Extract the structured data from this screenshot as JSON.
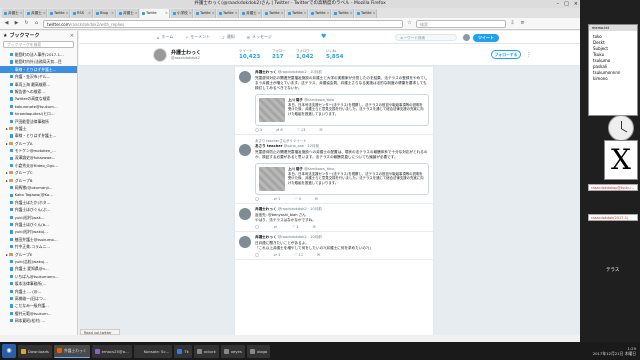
{
  "window": {
    "title": "弁護士わっく(@raackdokdok2)さん | Twitter - Twitterでの高精度のラベル - Mozilla Firefox",
    "controls": [
      "–",
      "□",
      "×"
    ]
  },
  "tabs": [
    {
      "label": "弁護士",
      "active": false
    },
    {
      "label": "弁護士",
      "active": false
    },
    {
      "label": "Twitte",
      "active": false
    },
    {
      "label": "RSS",
      "active": false
    },
    {
      "label": "Blog",
      "active": false
    },
    {
      "label": "弁護士",
      "active": false
    },
    {
      "label": "Twitte",
      "active": true
    },
    {
      "label": "小学校",
      "active": false
    },
    {
      "label": "Twitte",
      "active": false
    },
    {
      "label": "Twitte",
      "active": false
    },
    {
      "label": "弁護士",
      "active": false
    },
    {
      "label": "Twitte",
      "active": false
    },
    {
      "label": "Twitte",
      "active": false
    },
    {
      "label": "Twitte",
      "active": false
    },
    {
      "label": "Twitte",
      "active": false
    },
    {
      "label": "Twitte",
      "active": false
    }
  ],
  "navbar": {
    "url_host": "twitter.com",
    "url_path": "/raackdokdok2/with_replies",
    "search_placeholder": "検索"
  },
  "sidebar": {
    "title": "ブックマーク",
    "close": "×",
    "search_placeholder": "ブックマークを検索",
    "items": [
      {
        "label": "能登町の法人事件(2017-1…",
        "type": "fav",
        "selected": false
      },
      {
        "label": "能登町内外(法務局天気…目",
        "type": "fav",
        "selected": false
      },
      {
        "label": "車線・とりはず弁護士…",
        "type": "fav",
        "selected": true
      },
      {
        "label": "弁護・金沢市(ヤル…",
        "type": "fav",
        "selected": false
      },
      {
        "label": "車両上海 最高検察…",
        "type": "fav",
        "selected": false
      },
      {
        "label": "報告書への検索…",
        "type": "fav",
        "selected": false
      },
      {
        "label": "Twitterの高度な検索",
        "type": "fav",
        "selected": false
      },
      {
        "label": "kakuronote@tsukum…",
        "type": "fav",
        "selected": false
      },
      {
        "label": "hiroedaquitesi(ヒロ…",
        "type": "fav",
        "selected": false
      },
      {
        "label": "戸田能登法律事務所",
        "type": "fav",
        "selected": false
      },
      {
        "label": "弁護士",
        "type": "folder",
        "selected": false
      },
      {
        "label": "車線・とりはず弁護士…",
        "type": "fav",
        "selected": false
      },
      {
        "label": "グループA",
        "type": "folder",
        "selected": false
      },
      {
        "label": "モトケン@motoken_…",
        "type": "fav",
        "selected": false
      },
      {
        "label": "深澤諭史@fukazawa…",
        "type": "fav",
        "selected": false
      },
      {
        "label": "小倉秀夫@Hideo_Ogu…",
        "type": "fav",
        "selected": false
      },
      {
        "label": "グループC",
        "type": "folder",
        "selected": false
      },
      {
        "label": "グループB",
        "type": "folder",
        "selected": false
      },
      {
        "label": "岡馬猪(@okumanji…",
        "type": "fav",
        "selected": false
      },
      {
        "label": "Kako Tagawa(@Ka…",
        "type": "fav",
        "selected": false
      },
      {
        "label": "弁護士ほたか(ホタ…",
        "type": "fav",
        "selected": false
      },
      {
        "label": "弁護士ほびぐん(ぷ…",
        "type": "fav",
        "selected": false
      },
      {
        "label": "yuki(松村)wak…",
        "type": "fav",
        "selected": false
      },
      {
        "label": "弁護士ほびぐん(b…",
        "type": "fav",
        "selected": false
      },
      {
        "label": "yuki(松村)wakuj…",
        "type": "fav",
        "selected": false
      },
      {
        "label": "植田弁護士@tsukumo…",
        "type": "fav",
        "selected": false
      },
      {
        "label": "竹中正美-コラムニ…",
        "type": "fav",
        "selected": false
      },
      {
        "label": "グループE",
        "type": "folder",
        "selected": false
      },
      {
        "label": "yuki(吉松)wakuj…",
        "type": "fav",
        "selected": false
      },
      {
        "label": "弁護士 愛知県@n…",
        "type": "fav",
        "selected": false
      },
      {
        "label": "いちばん@tsukumonn…",
        "type": "fav",
        "selected": false
      },
      {
        "label": "坂本法律事務所(…",
        "type": "fav",
        "selected": false
      },
      {
        "label": "弁護士 … (@…",
        "type": "fav",
        "selected": false
      },
      {
        "label": "高橋雄一(旧はつ…",
        "type": "fav",
        "selected": false
      },
      {
        "label": "こだなみ一級弁護…",
        "type": "fav",
        "selected": false
      },
      {
        "label": "櫻井元範@tsukum…",
        "type": "fav",
        "selected": false
      },
      {
        "label": "岡本寛昭(松村) …",
        "type": "fav",
        "selected": false
      }
    ]
  },
  "twitter": {
    "nav": [
      {
        "icon": "home-icon",
        "label": "ホーム"
      },
      {
        "icon": "moments-icon",
        "label": "モーメント"
      },
      {
        "icon": "bell-icon",
        "label": "通知"
      },
      {
        "icon": "mail-icon",
        "label": "メッセージ"
      }
    ],
    "search_placeholder": "キーワード検索",
    "tweet_button": "ツイート",
    "profile": {
      "name": "弁護士わっく",
      "handle": "@raackdokdok2",
      "stats": [
        {
          "label": "ツイート",
          "value": "10,423"
        },
        {
          "label": "フォロー",
          "value": "217"
        },
        {
          "label": "フォロワー",
          "value": "1,042"
        },
        {
          "label": "いいね",
          "value": "5,854"
        }
      ],
      "follow_button": "フォローする",
      "more": "⋮"
    },
    "tweets": [
      {
        "context": "",
        "name": "弁護士わっく",
        "handle": "@raackdokdok2 · 10月前",
        "text": "児童虐待対応の関連児童福祉施設の弁護士と大学の実務家が分担したのを結果。法テラスの登録をやめてしまう弁護士が増えています。法テラス、弁護協会員、弁護士さらなる実施は法的な制度の健康を要求しても検討してみるべきでないか。",
        "quote": {
          "name": "上川 陽子",
          "handle": "@Kamikawa_Yoko",
          "text": "本日、日本司法支援センター(法テラス)を視察し、法テラスの役割や取組事項等の説明を受けた後、弁護士らと意見交換を行いました。法テラスを通じて総合法律支援の充実に向けた取組を推進してまいります。"
        },
        "actions": [
          "2",
          "8",
          "13"
        ]
      },
      {
        "context": "あさり teacherさんがリツイート",
        "name": "あさり teacher",
        "handle": "@sono_sae · 12月前",
        "text": "児童虐待防止の関連児童福祉施設への弁護士の配置は、現状の法テラスの報酬体系で十分な対応がとれるのか、検証する必要があると思います。法テラスの報酬見直しについても議論が必要です。",
        "quote": {
          "name": "上川 陽子",
          "handle": "@Kamikawa_Yoko",
          "text": "本日、日本司法支援センター(法テラス)を視察し、法テラスの役割や取組事項等の説明を受けた後、弁護士らと意見交換を行いました。法テラスを通じて総合法律支援の充実に向けた取組を推進してまいります。"
        },
        "actions": [
          "",
          "1",
          "4"
        ]
      },
      {
        "context": "",
        "name": "弁護士わっく",
        "handle": "@raackdokdok2 · 10月前",
        "text": "返信先: @benyoshi_blah さん\nやはり、法テラスはなかなかですね。",
        "quote": null,
        "actions": [
          "",
          "",
          "1"
        ]
      },
      {
        "context": "",
        "name": "弁護士わっく",
        "handle": "@raackdokdok2 · 10月前",
        "text": "日弁連に聞きたいことがあるよ。\n『これ以上弁護士を増やして何をしたいの?(弁護士に何を求めたいの?)』",
        "quote": null,
        "actions": [
          "",
          "3",
          "11"
        ]
      }
    ]
  },
  "status_text": "Read vol.twitter",
  "desktop": {
    "window_title": "memo.txt",
    "window_lines": [
      "toko",
      "Deskt",
      "Subject",
      "Tsuku",
      "tsukumo",
      "paskali",
      "tsukumonnnn",
      "kimono"
    ],
    "x_logo": "X",
    "link1": "rasacdokdokop@tsuku…",
    "link2": "rasacdokdok(2017-1)",
    "text_label": "テラス"
  },
  "taskbar": {
    "start": "◉",
    "items": [
      {
        "label": "Downloads",
        "color": "#d9a441",
        "active": false
      },
      {
        "label": "弁護士わっく",
        "color": "#e66000",
        "active": true
      },
      {
        "label": "emacs25@a…",
        "color": "#8a63c2",
        "active": false
      },
      {
        "label": "Konsole: Sc…",
        "color": "#333333",
        "active": false
      },
      {
        "label": "Tk",
        "color": "#3a7bd5",
        "active": false
      },
      {
        "label": "xclock",
        "color": "#888888",
        "active": false
      },
      {
        "label": "xeyes",
        "color": "#888888",
        "active": false
      },
      {
        "label": "xlogo",
        "color": "#888888",
        "active": false
      }
    ],
    "time": "1:29",
    "date": "2017年12月21日 木曜日"
  }
}
